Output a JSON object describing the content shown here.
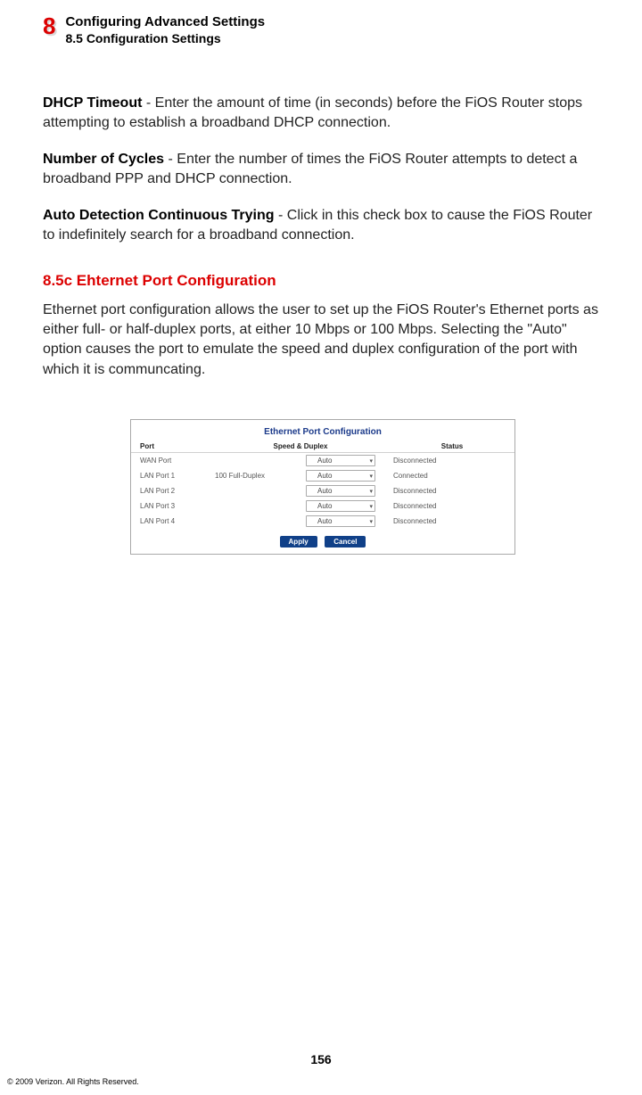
{
  "header": {
    "chapter_number": "8",
    "chapter_title": "Configuring Advanced Settings",
    "section_title": "8.5  Configuration Settings"
  },
  "paragraphs": {
    "p1_label": "DHCP Timeout",
    "p1_text": " - Enter the amount of time (in seconds) before the FiOS Router stops attempting to establish a broadband DHCP connection.",
    "p2_label": "Number of Cycles",
    "p2_text": " - Enter the number of times the FiOS Router attempts to detect a broadband PPP and DHCP connection.",
    "p3_label": "Auto Detection Continuous Trying",
    "p3_text": " - Click in this check box to cause the FiOS Router to indefinitely search for a broadband connection."
  },
  "subsection": {
    "title": "8.5c  Ehternet Port Configuration",
    "desc": "Ethernet port configuration allows the user to set up the FiOS Router's Ethernet ports as either full- or half-duplex ports, at either 10 Mbps or 100 Mbps. Selecting the \"Auto\" option causes the port to emulate the speed and duplex configuration of the port with which it is communcating."
  },
  "table": {
    "title": "Ethernet Port Configuration",
    "headers": {
      "port": "Port",
      "speed": "Speed & Duplex",
      "status": "Status"
    },
    "rows": [
      {
        "port": "WAN Port",
        "speed": "",
        "select": "Auto",
        "status": "Disconnected",
        "status_class": "status-disconnected"
      },
      {
        "port": "LAN Port 1",
        "speed": "100 Full-Duplex",
        "select": "Auto",
        "status": "Connected",
        "status_class": "status-connected"
      },
      {
        "port": "LAN Port 2",
        "speed": "",
        "select": "Auto",
        "status": "Disconnected",
        "status_class": "status-disconnected"
      },
      {
        "port": "LAN Port 3",
        "speed": "",
        "select": "Auto",
        "status": "Disconnected",
        "status_class": "status-disconnected"
      },
      {
        "port": "LAN Port 4",
        "speed": "",
        "select": "Auto",
        "status": "Disconnected",
        "status_class": "status-disconnected"
      }
    ],
    "buttons": {
      "apply": "Apply",
      "cancel": "Cancel"
    }
  },
  "footer": {
    "page_number": "156",
    "copyright": "© 2009 Verizon. All Rights Reserved."
  }
}
